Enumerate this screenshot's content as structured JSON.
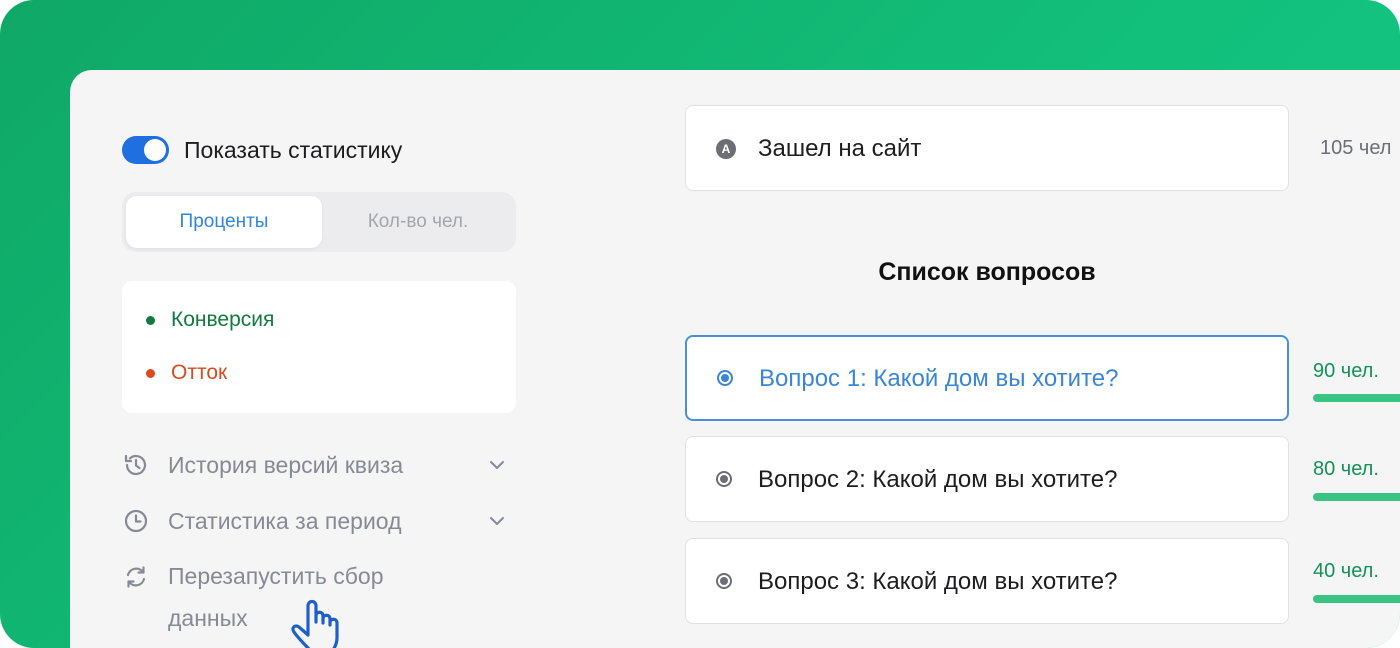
{
  "sidebar": {
    "toggle": {
      "label": "Показать статистику",
      "on": true
    },
    "segment": {
      "active": "Проценты",
      "inactive": "Кол-во чел."
    },
    "legend": [
      {
        "label": "Конверсия",
        "color": "#127a3e"
      },
      {
        "label": "Отток",
        "color": "#d94a1f"
      }
    ],
    "menu": [
      {
        "label": "История версий квиза",
        "icon": "history-icon",
        "has_chevron": true
      },
      {
        "label": "Статистика за период",
        "icon": "clock-icon",
        "has_chevron": true
      },
      {
        "label_line1": "Перезапустить сбор",
        "label_line2": "данных",
        "icon": "refresh-icon",
        "has_chevron": false
      }
    ]
  },
  "entry": {
    "badge": "A",
    "label": "Зашел на сайт",
    "count": "105 чел"
  },
  "questions_title": "Список вопросов",
  "questions": [
    {
      "label": "Вопрос 1: Какой дом вы хотите?",
      "count": "90 чел.",
      "selected": true
    },
    {
      "label": "Вопрос 2: Какой дом вы хотите?",
      "count": "80 чел.",
      "selected": false
    },
    {
      "label": "Вопрос 3: Какой дом вы хотите?",
      "count": "40 чел.",
      "selected": false
    }
  ],
  "colors": {
    "accent_blue": "#1f6fe0",
    "selected_blue": "#3a85d6",
    "green": "#139257",
    "bar_green": "#39c483",
    "background_gradient_start": "#10a866",
    "background_gradient_end": "#18c98a"
  }
}
